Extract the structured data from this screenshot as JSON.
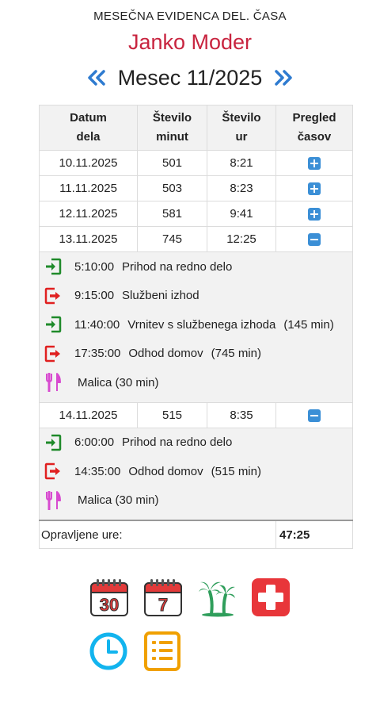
{
  "header": {
    "subtitle": "MESEČNA EVIDENCA DEL. ČASA",
    "user": "Janko Moder",
    "month_label": "Mesec 11/2025"
  },
  "table": {
    "headers": [
      "Datum dela",
      "Število minut",
      "Število ur",
      "Pregled časov"
    ],
    "days": [
      {
        "date": "10.11.2025",
        "minutes": "501",
        "hours": "8:21",
        "state": "plus"
      },
      {
        "date": "11.11.2025",
        "minutes": "503",
        "hours": "8:23",
        "state": "plus"
      },
      {
        "date": "12.11.2025",
        "minutes": "581",
        "hours": "9:41",
        "state": "plus"
      },
      {
        "date": "13.11.2025",
        "minutes": "745",
        "hours": "12:25",
        "state": "minus",
        "details": [
          {
            "type": "in",
            "time": "5:10:00",
            "label": "Prihod na redno delo",
            "extra": ""
          },
          {
            "type": "out",
            "time": "9:15:00",
            "label": "Službeni izhod",
            "extra": ""
          },
          {
            "type": "in",
            "time": "11:40:00",
            "label": "Vrnitev s službenega izhoda",
            "extra": "(145 min)"
          },
          {
            "type": "out",
            "time": "17:35:00",
            "label": "Odhod domov",
            "extra": "(745 min)"
          },
          {
            "type": "meal",
            "time": "",
            "label": "Malica (30 min)",
            "extra": ""
          }
        ]
      },
      {
        "date": "14.11.2025",
        "minutes": "515",
        "hours": "8:35",
        "state": "minus",
        "details": [
          {
            "type": "in",
            "time": "6:00:00",
            "label": "Prihod na redno delo",
            "extra": ""
          },
          {
            "type": "out",
            "time": "14:35:00",
            "label": "Odhod domov",
            "extra": "(515 min)"
          },
          {
            "type": "meal",
            "time": "",
            "label": "Malica (30 min)",
            "extra": ""
          }
        ]
      }
    ],
    "total_label": "Opravljene ure:",
    "total_value": "47:25"
  },
  "toolbar": {
    "calendar_month_text": "30",
    "calendar_week_text": "7",
    "icons": [
      "calendar-month-icon",
      "calendar-week-icon",
      "vacation-palm-icon",
      "sick-leave-cross-icon",
      "clock-icon",
      "list-icon"
    ]
  },
  "colors": {
    "accent_red": "#c8243f",
    "nav_blue": "#2e7bd0",
    "in_green": "#1f8a2a",
    "out_red": "#e02020",
    "meal_pink": "#d84bd0"
  }
}
